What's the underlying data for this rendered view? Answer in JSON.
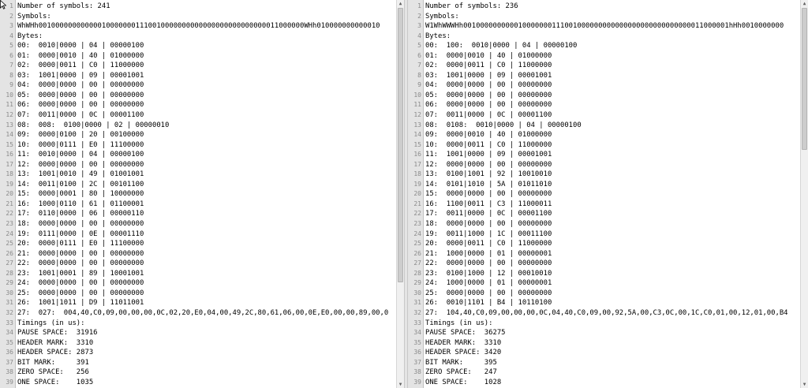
{
  "left_pane": {
    "lines": [
      "Number of symbols: 241",
      "Symbols:",
      "WhWHh001000000000000100000001110010000000000000000000000000011000000WHh010000000000010",
      "Bytes:",
      "00:  0010|0000 | 04 | 00000100",
      "01:  0000|0010 | 40 | 01000000",
      "02:  0000|0011 | C0 | 11000000",
      "03:  1001|0000 | 09 | 00001001",
      "04:  0000|0000 | 00 | 00000000",
      "05:  0000|0000 | 00 | 00000000",
      "06:  0000|0000 | 00 | 00000000",
      "07:  0011|0000 | 0C | 00001100",
      "08:  008:  0100|0000 | 02 | 00000010",
      "09:  0000|0100 | 20 | 00100000",
      "10:  0000|0111 | E0 | 11100000",
      "11:  0010|0000 | 04 | 00000100",
      "12:  0000|0000 | 00 | 00000000",
      "13:  1001|0010 | 49 | 01001001",
      "14:  0011|0100 | 2C | 00101100",
      "15:  0000|0001 | 80 | 10000000",
      "16:  1000|0110 | 61 | 01100001",
      "17:  0110|0000 | 06 | 00000110",
      "18:  0000|0000 | 00 | 00000000",
      "19:  0111|0000 | 0E | 00001110",
      "20:  0000|0111 | E0 | 11100000",
      "21:  0000|0000 | 00 | 00000000",
      "22:  0000|0000 | 00 | 00000000",
      "23:  1001|0001 | 89 | 10001001",
      "24:  0000|0000 | 00 | 00000000",
      "25:  0000|0000 | 00 | 00000000",
      "26:  1001|1011 | D9 | 11011001",
      "27:  027:  004,40,C0,09,00,00,00,0C,02,20,E0,04,00,49,2C,80,61,06,00,0E,E0,00,00,89,00,0",
      "Timings (in us):",
      "PAUSE SPACE:  31916",
      "HEADER MARK:  3310",
      "HEADER SPACE: 2873",
      "BIT MARK:     391",
      "ZERO SPACE:   256",
      "ONE SPACE:    1035"
    ]
  },
  "right_pane": {
    "lines": [
      "Number of symbols: 236",
      "Symbols:",
      "W1WhWWWHh001000000000010000000111001000000000000000000000000000011000001hHh0010000000",
      "Bytes:",
      "00:  100:  0010|0000 | 04 | 00000100",
      "01:  0000|0010 | 40 | 01000000",
      "02:  0000|0011 | C0 | 11000000",
      "03:  1001|0000 | 09 | 00001001",
      "04:  0000|0000 | 00 | 00000000",
      "05:  0000|0000 | 00 | 00000000",
      "06:  0000|0000 | 00 | 00000000",
      "07:  0011|0000 | 0C | 00001100",
      "08:  0108:  0010|0000 | 04 | 00000100",
      "09:  0000|0010 | 40 | 01000000",
      "10:  0000|0011 | C0 | 11000000",
      "11:  1001|0000 | 09 | 00001001",
      "12:  0000|0000 | 00 | 00000000",
      "13:  0100|1001 | 92 | 10010010",
      "14:  0101|1010 | 5A | 01011010",
      "15:  0000|0000 | 00 | 00000000",
      "16:  1100|0011 | C3 | 11000011",
      "17:  0011|0000 | 0C | 00001100",
      "18:  0000|0000 | 00 | 00000000",
      "19:  0011|1000 | 1C | 00011100",
      "20:  0000|0011 | C0 | 11000000",
      "21:  1000|0000 | 01 | 00000001",
      "22:  0000|0000 | 00 | 00000000",
      "23:  0100|1000 | 12 | 00010010",
      "24:  1000|0000 | 01 | 00000001",
      "25:  0000|0000 | 00 | 00000000",
      "26:  0010|1101 | B4 | 10110100",
      "27:  104,40,C0,09,00,00,00,0C,04,40,C0,09,00,92,5A,00,C3,0C,00,1C,C0,01,00,12,01,00,B4",
      "Timings (in us):",
      "PAUSE SPACE:  36275",
      "HEADER MARK:  3310",
      "HEADER SPACE: 3420",
      "BIT MARK:     395",
      "ZERO SPACE:   247",
      "ONE SPACE:    1028"
    ]
  },
  "colors": {
    "gutter": "#e4e4e4",
    "line_numbers": "#8a8a8a",
    "text": "#000000",
    "current_line": "#e8e8ff"
  }
}
